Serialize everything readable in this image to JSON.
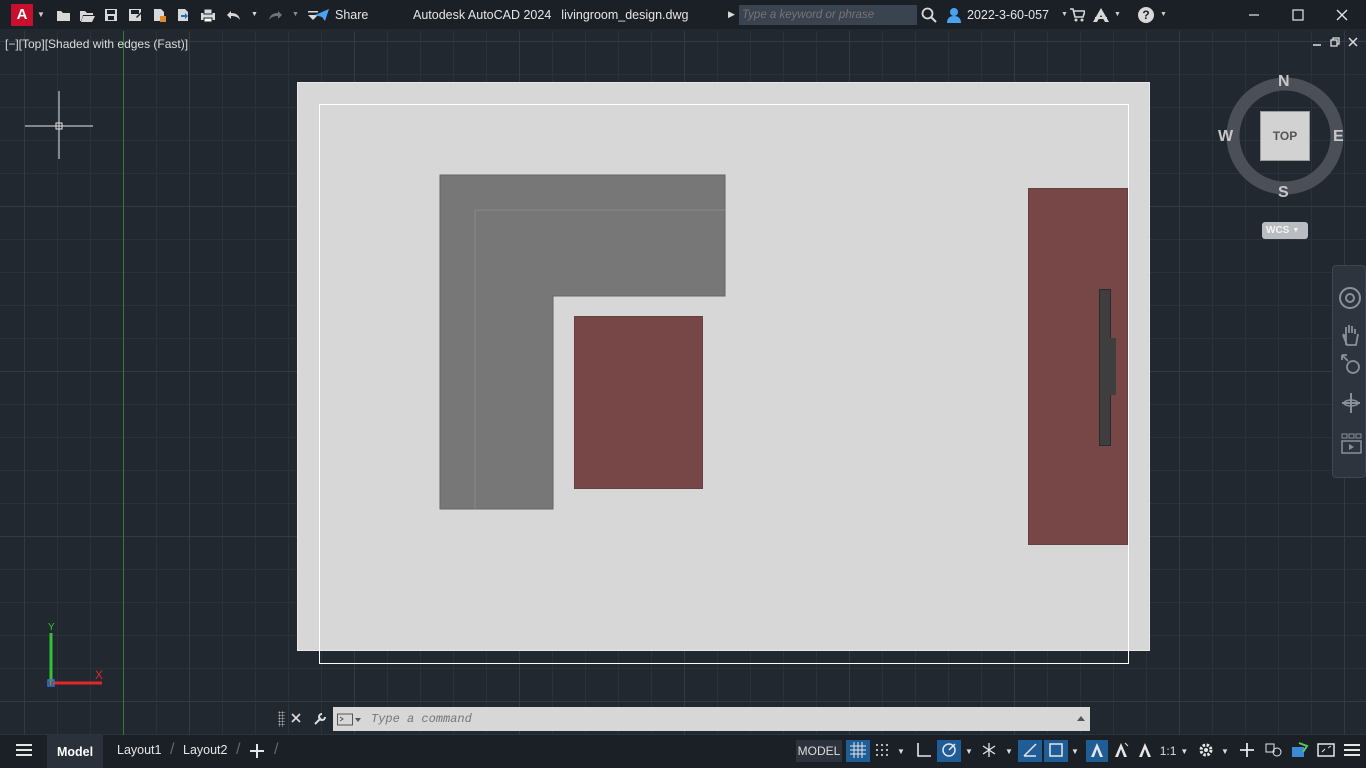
{
  "app": {
    "title": "Autodesk AutoCAD 2024",
    "filename": "livingroom_design.dwg",
    "logo_letter": "A",
    "share_label": "Share",
    "search_placeholder": "Type a keyword or phrase",
    "user_name": "2022-3-60-057",
    "help_glyph": "?"
  },
  "viewport": {
    "label": "[−][Top][Shaded with edges (Fast)]",
    "viewcube": {
      "top": "TOP",
      "north": "N",
      "south": "S",
      "east": "E",
      "west": "W",
      "ucs": "WCS"
    },
    "ucs_axes": {
      "x": "X",
      "y": "Y"
    }
  },
  "command": {
    "placeholder": "Type a command"
  },
  "tabs": [
    "Model",
    "Layout1",
    "Layout2"
  ],
  "status": {
    "model_label": "MODEL",
    "scale_label": "1:1"
  },
  "colors": {
    "furniture": "#774646",
    "sofa": "#777777",
    "paper": "#d7d7d7",
    "background": "#212830"
  }
}
